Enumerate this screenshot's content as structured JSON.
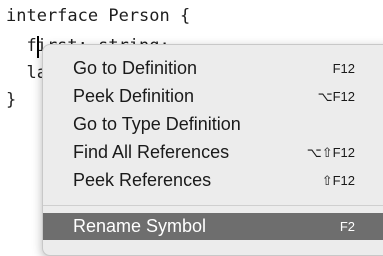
{
  "editor": {
    "lines": [
      "interface Person {",
      "  first: string;",
      "  la",
      "}"
    ]
  },
  "context_menu": {
    "items": [
      {
        "label": "Go to Definition",
        "shortcut": "F12"
      },
      {
        "label": "Peek Definition",
        "shortcut": "⌥F12"
      },
      {
        "label": "Go to Type Definition",
        "shortcut": ""
      },
      {
        "label": "Find All References",
        "shortcut": "⌥⇧F12"
      },
      {
        "label": "Peek References",
        "shortcut": "⇧F12"
      },
      {
        "label": "Rename Symbol",
        "shortcut": "F2",
        "selected": true
      }
    ]
  },
  "colors": {
    "menu_background": "#ececec",
    "selected_background": "#6e6e6e"
  }
}
